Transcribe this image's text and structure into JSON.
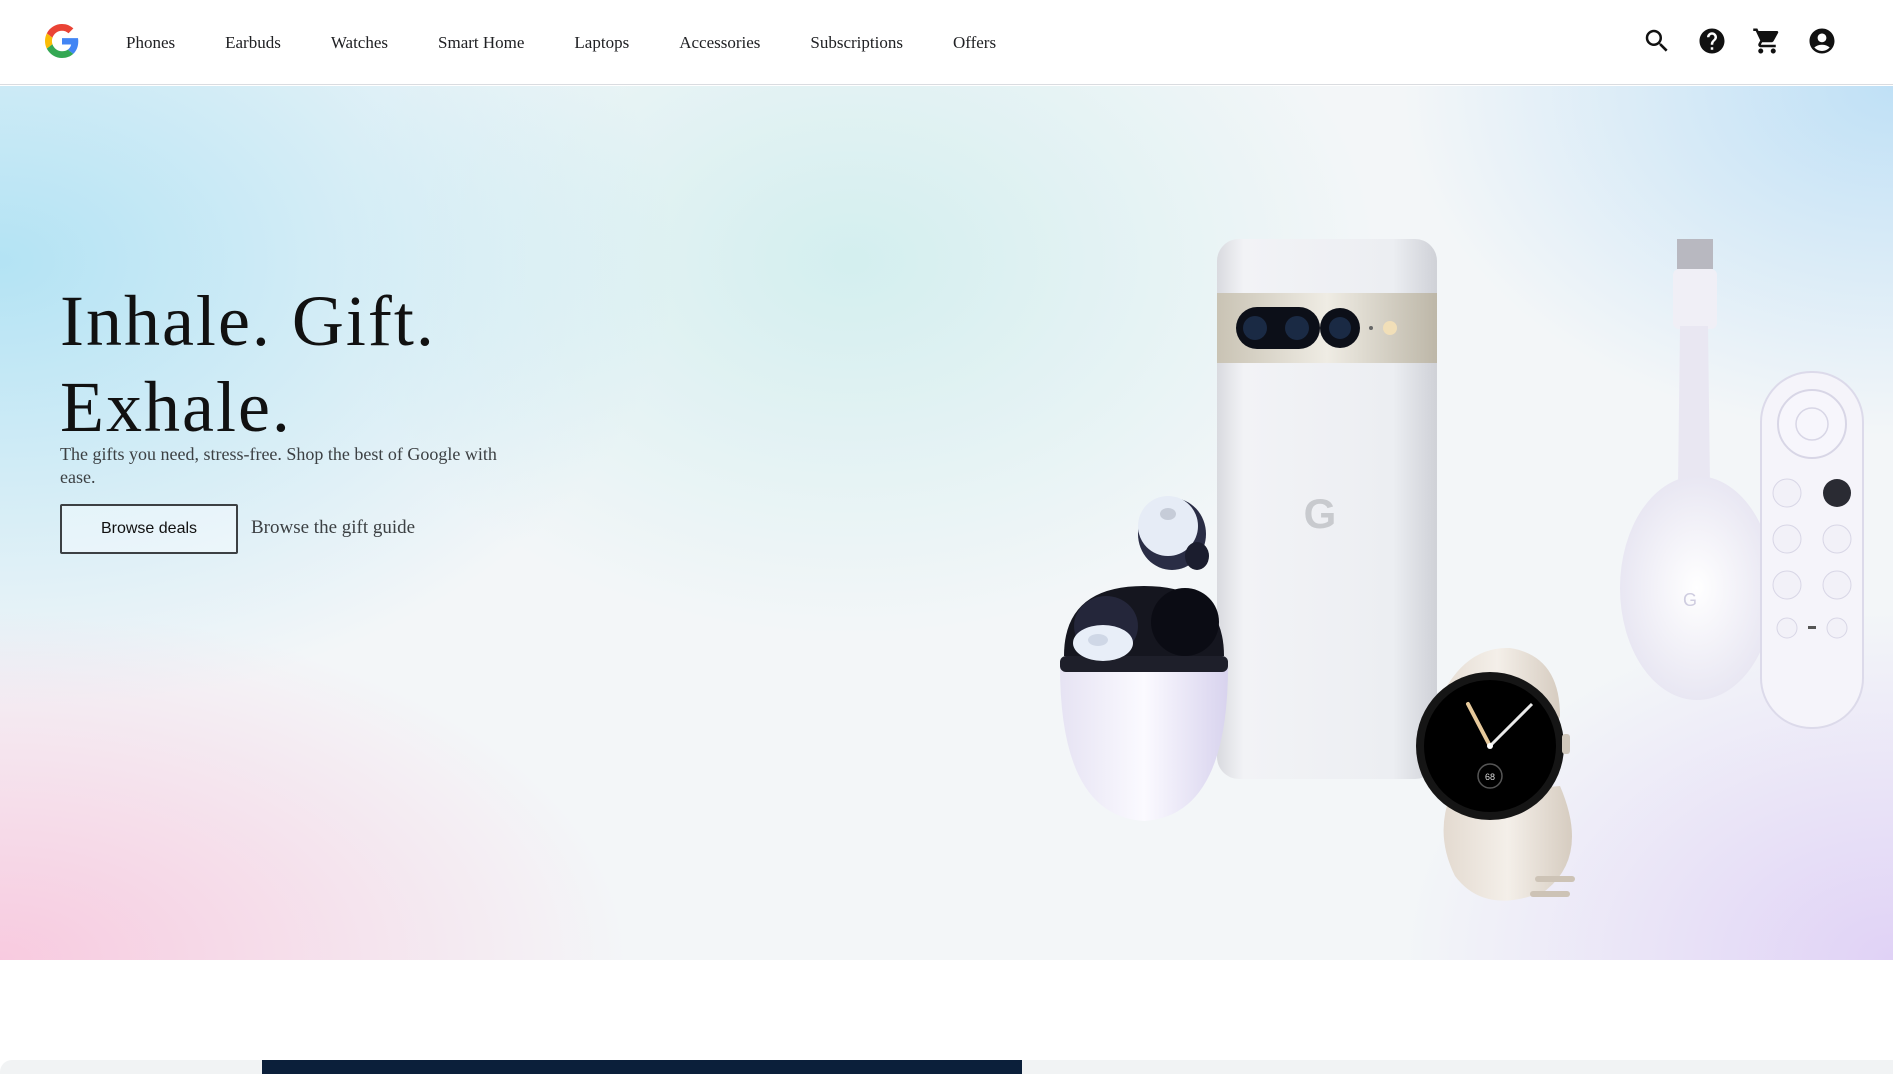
{
  "header": {
    "logo_icon": "google-g-logo",
    "nav": [
      {
        "label": "Phones"
      },
      {
        "label": "Earbuds"
      },
      {
        "label": "Watches"
      },
      {
        "label": "Smart Home"
      },
      {
        "label": "Laptops"
      },
      {
        "label": "Accessories"
      },
      {
        "label": "Subscriptions"
      },
      {
        "label": "Offers"
      }
    ],
    "icons": [
      "search-icon",
      "help-icon",
      "cart-icon",
      "account-icon"
    ]
  },
  "hero": {
    "title_line1": "Inhale. Gift.",
    "title_line2": "Exhale.",
    "subtitle": "The gifts you need, stress-free. Shop the best of Google with ease.",
    "primary_button": "Browse deals",
    "secondary_link": "Browse the gift guide",
    "watch_readout": "68"
  },
  "colors": {
    "text": "#202124",
    "accent_dark": "#0b1f3a",
    "google_blue": "#4285F4",
    "google_red": "#EA4335",
    "google_yellow": "#FBBC05",
    "google_green": "#34A853"
  }
}
